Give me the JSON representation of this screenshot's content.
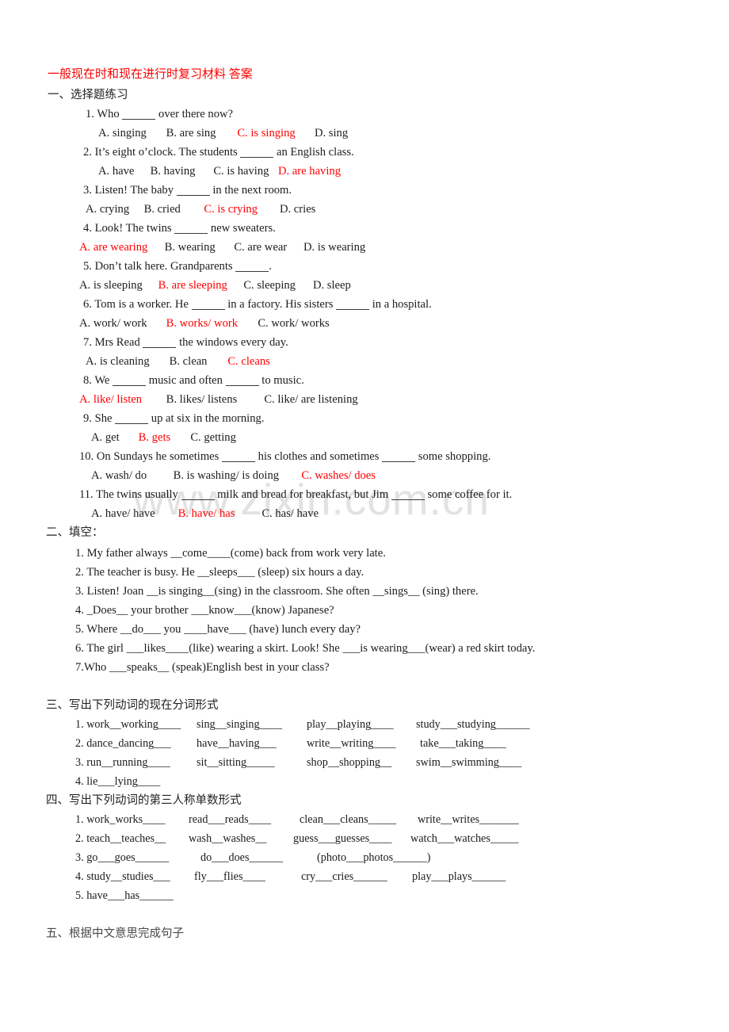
{
  "document": {
    "title": "一般现在时和现在进行时复习材料  答案",
    "watermark": "www.zixin.com.cn"
  },
  "section_one": {
    "heading": "一、选择题练习",
    "questions": [
      {
        "number": "1.",
        "stem_before": "1. Who",
        "stem_after": "over there now?",
        "options": [
          {
            "text": "A. singing",
            "correct": false
          },
          {
            "text": "B. are sing",
            "correct": false
          },
          {
            "text": "C. is singing",
            "correct": true
          },
          {
            "text": "D. sing",
            "correct": false
          }
        ]
      },
      {
        "number": "2.",
        "stem_before": "2. It’s eight o’clock. The students",
        "stem_after": "an English class.",
        "options": [
          {
            "text": "A. have",
            "correct": false
          },
          {
            "text": "B. having",
            "correct": false
          },
          {
            "text": "C. is having",
            "correct": false
          },
          {
            "text": "D. are having",
            "correct": true
          }
        ]
      },
      {
        "number": "3.",
        "stem_before": "3. Listen! The baby",
        "stem_after": "in the next room.",
        "options": [
          {
            "text": "A. crying",
            "correct": false
          },
          {
            "text": "B. cried",
            "correct": false
          },
          {
            "text": "C. is crying",
            "correct": true
          },
          {
            "text": "D. cries",
            "correct": false
          }
        ]
      },
      {
        "number": "4.",
        "stem_before": "4. Look! The twins",
        "stem_after": "new sweaters.",
        "options": [
          {
            "text": "A. are wearing",
            "correct": true
          },
          {
            "text": "B. wearing",
            "correct": false
          },
          {
            "text": "C. are wear",
            "correct": false
          },
          {
            "text": "D. is wearing",
            "correct": false
          }
        ]
      },
      {
        "number": "5.",
        "stem_before": "5. Don’t talk here. Grandparents",
        "stem_after": ".",
        "options": [
          {
            "text": "A. is sleeping",
            "correct": false
          },
          {
            "text": "B. are sleeping",
            "correct": true
          },
          {
            "text": "C. sleeping",
            "correct": false
          },
          {
            "text": "D. sleep",
            "correct": false
          }
        ]
      },
      {
        "number": "6.",
        "stem_before": "6. Tom is a worker. He",
        "stem_mid": "in a factory. His sisters",
        "stem_after": "in a hospital.",
        "options": [
          {
            "text": "A. work/ work",
            "correct": false
          },
          {
            "text": "B. works/ work",
            "correct": true
          },
          {
            "text": "C. work/ works",
            "correct": false
          }
        ]
      },
      {
        "number": "7.",
        "stem_before": "7. Mrs Read",
        "stem_after": "the windows every day.",
        "options": [
          {
            "text": "A. is cleaning",
            "correct": false
          },
          {
            "text": "B. clean",
            "correct": false
          },
          {
            "text": "C. cleans",
            "correct": true
          }
        ]
      },
      {
        "number": "8.",
        "stem_before": "8. We",
        "stem_mid": "music and often",
        "stem_after": "to music.",
        "options": [
          {
            "text": "A. like/ listen",
            "correct": true
          },
          {
            "text": "B. likes/ listens",
            "correct": false
          },
          {
            "text": "C. like/ are listening",
            "correct": false
          }
        ]
      },
      {
        "number": "9.",
        "stem_before": "9. She",
        "stem_after": "up at six in the morning.",
        "options": [
          {
            "text": "A. get",
            "correct": false
          },
          {
            "text": "B. gets",
            "correct": true
          },
          {
            "text": "C. getting",
            "correct": false
          }
        ]
      },
      {
        "number": "10.",
        "stem_before": "10. On Sundays he sometimes",
        "stem_mid": "his clothes and sometimes",
        "stem_after": "some shopping.",
        "options": [
          {
            "text": "A. wash/ do",
            "correct": false
          },
          {
            "text": "B. is washing/ is doing",
            "correct": false
          },
          {
            "text": "C. washes/ does",
            "correct": true
          }
        ]
      },
      {
        "number": "11.",
        "stem_before": "11. The twins usually",
        "stem_mid": "milk and bread for breakfast, but Jim",
        "stem_after": "some coffee for it.",
        "options": [
          {
            "text": "A. have/ have",
            "correct": false
          },
          {
            "text": "B. have/ has",
            "correct": true
          },
          {
            "text": "C. has/ have",
            "correct": false
          }
        ]
      }
    ]
  },
  "section_two": {
    "heading": "二、填空：",
    "items": [
      "1. My father always __come____(come) back from work very late.",
      "2. The teacher is busy. He __sleeps___ (sleep) six hours a day.",
      "3. Listen! Joan __is singing__(sing) in the classroom. She often __sings__ (sing) there.",
      "4. _Does__ your brother ___know___(know) Japanese?",
      "5. Where __do___ you ____have___ (have) lunch every day?",
      "6. The girl ___likes____(like) wearing a skirt. Look! She ___is wearing___(wear) a red skirt today.",
      "7.Who ___speaks__ (speak)English best in your class?"
    ]
  },
  "section_three": {
    "heading": "三、写出下列动词的现在分词形式",
    "rows": [
      [
        "1. work__working____",
        "sing__singing____",
        "play__playing____",
        "study___studying______"
      ],
      [
        "2. dance_dancing___",
        "have__having___",
        "write__writing____",
        "take___taking____"
      ],
      [
        "3. run__running____",
        "sit__sitting_____",
        "shop__shopping__",
        "swim__swimming____"
      ],
      [
        "4. lie___lying____",
        "",
        "",
        ""
      ]
    ]
  },
  "section_four": {
    "heading": "四、写出下列动词的第三人称单数形式",
    "rows": [
      [
        "1. work_works____",
        "read___reads____",
        "clean___cleans_____",
        "write__writes_______"
      ],
      [
        "2. teach__teaches__",
        "wash__washes__",
        "guess___guesses____",
        "watch___watches_____"
      ],
      [
        "3. go___goes______",
        "do___does______",
        "(photo___photos______)",
        ""
      ],
      [
        "4. study__studies___",
        "fly___flies____",
        "cry___cries______",
        "play___plays______"
      ],
      [
        "5. have___has______",
        "",
        "",
        ""
      ]
    ]
  },
  "section_five": {
    "heading": "五、根据中文意思完成句子"
  }
}
